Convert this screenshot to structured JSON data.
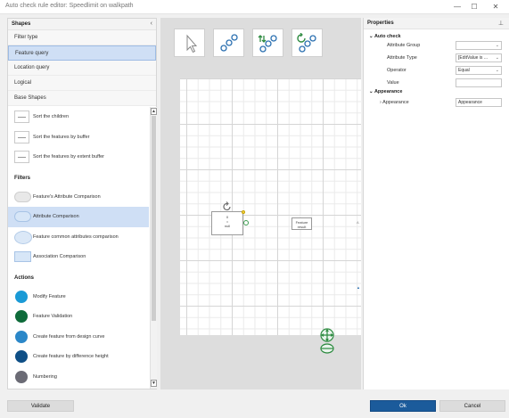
{
  "window": {
    "title": "Auto check rule editor: Speedlimit on walkpath",
    "minimize_icon": "—",
    "maximize_icon": "☐",
    "close_icon": "✕"
  },
  "shapes_panel": {
    "title": "Shapes",
    "collapse_icon": "chevron-left-icon",
    "tabs": [
      {
        "label": "Filter type"
      },
      {
        "label": "Feature query"
      },
      {
        "label": "Location query"
      },
      {
        "label": "Logical"
      },
      {
        "label": "Base Shapes"
      }
    ],
    "items": [
      {
        "label": "Sort the children"
      },
      {
        "label": "Sort the features by buffer"
      },
      {
        "label": "Sort the features by extent buffer"
      }
    ],
    "filters_heading": "Filters",
    "filters": [
      {
        "label": "Feature's Attribute Comparison"
      },
      {
        "label": "Attribute Comparison"
      },
      {
        "label": "Feature common attributes comparison"
      },
      {
        "label": "Association Comparison"
      }
    ],
    "actions_heading": "Actions",
    "actions": [
      {
        "label": "Modify Feature",
        "color": "#1a9ad6"
      },
      {
        "label": "Feature Validation",
        "color": "#0e6b3a"
      },
      {
        "label": "Create feature from design curve",
        "color": "#2b87c8"
      },
      {
        "label": "Create feature by difference height",
        "color": "#0f4f86"
      },
      {
        "label": "Numbering",
        "color": "#6b6b75"
      }
    ]
  },
  "canvas": {
    "node_a": {
      "line1": "0",
      "line2": "=",
      "line3": "null"
    },
    "node_b": {
      "line1": "Feature",
      "line2": "result"
    }
  },
  "properties_panel": {
    "title": "Properties",
    "pin_icon": "pin-icon",
    "auto_check_heading": "Auto check",
    "rows": [
      {
        "label": "Attribute Group",
        "value": "",
        "dropdown": true
      },
      {
        "label": "Attribute Type",
        "value": "[EditValue is ...",
        "dropdown": true
      },
      {
        "label": "Operator",
        "value": "Equal",
        "dropdown": true
      },
      {
        "label": "Value",
        "value": "",
        "dropdown": false
      }
    ],
    "appearance_heading": "Appearance",
    "appearance_row": {
      "label": "Appearance",
      "value": "Appearance"
    }
  },
  "footer": {
    "validate": "Validate",
    "ok": "Ok",
    "cancel": "Cancel"
  }
}
